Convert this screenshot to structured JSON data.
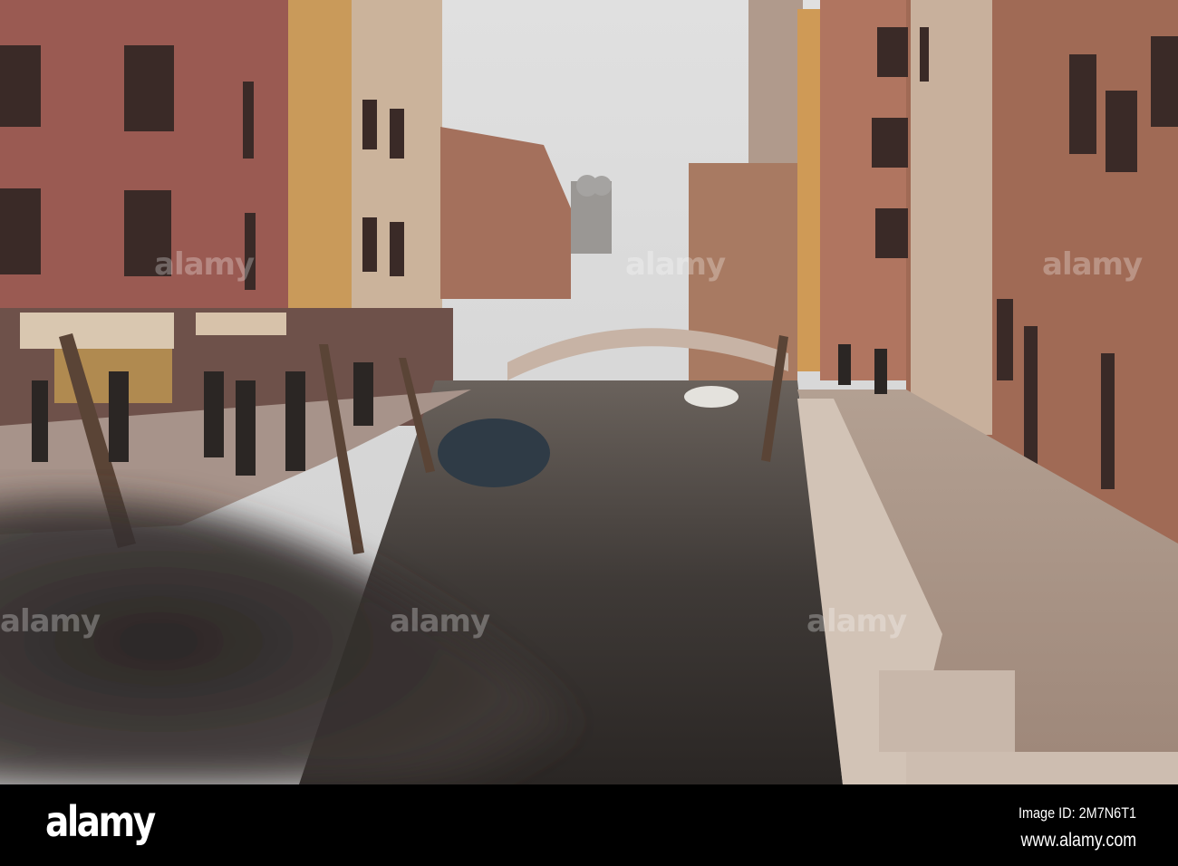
{
  "photo": {
    "subject": "Venice canal with bridge",
    "watermark_text": "alamy"
  },
  "footer": {
    "logo": "alamy",
    "image_id": "Image ID: 2M7N6T1",
    "website": "www.alamy.com"
  },
  "colors": {
    "sky": "#d9d9d9",
    "left_building": "#9a5a52",
    "right_brick": "#a06a55",
    "walkway": "#a89282",
    "water": "#3e3a38",
    "footer_bg": "#000000"
  }
}
